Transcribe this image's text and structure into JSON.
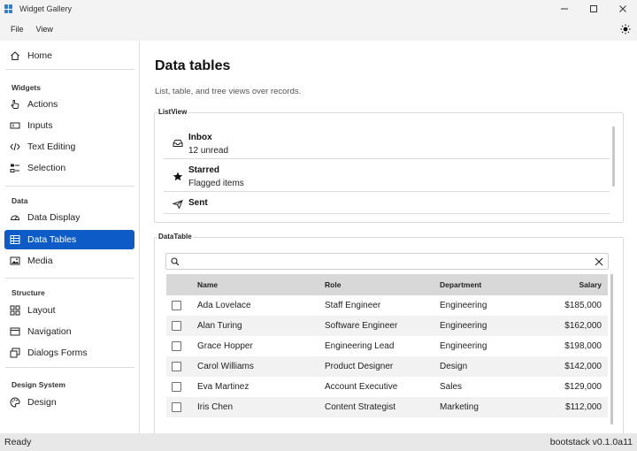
{
  "window": {
    "title": "Widget Gallery"
  },
  "menu": {
    "items": [
      "File",
      "View"
    ]
  },
  "sidebar": {
    "home": "Home",
    "sections": [
      {
        "label": "Widgets",
        "items": [
          "Actions",
          "Inputs",
          "Text Editing",
          "Selection"
        ]
      },
      {
        "label": "Data",
        "items": [
          "Data Display",
          "Data Tables",
          "Media"
        ]
      },
      {
        "label": "Structure",
        "items": [
          "Layout",
          "Navigation",
          "Dialogs  Forms"
        ]
      },
      {
        "label": "Design System",
        "items": [
          "Design"
        ]
      }
    ],
    "active_item": "Data Tables"
  },
  "main": {
    "title": "Data tables",
    "subtitle": "List, table, and tree views over records.",
    "listview": {
      "label": "ListView",
      "items": [
        {
          "title": "Inbox",
          "subtitle": "12 unread",
          "icon": "inbox-icon"
        },
        {
          "title": "Starred",
          "subtitle": "Flagged items",
          "icon": "star-icon"
        },
        {
          "title": "Sent",
          "subtitle": "",
          "icon": "send-icon"
        }
      ]
    },
    "datatable": {
      "label": "DataTable",
      "search": {
        "value": "",
        "placeholder": ""
      },
      "columns": [
        "Name",
        "Role",
        "Department",
        "Salary"
      ],
      "rows": [
        [
          "Ada Lovelace",
          "Staff Engineer",
          "Engineering",
          "$185,000"
        ],
        [
          "Alan Turing",
          "Software Engineer",
          "Engineering",
          "$162,000"
        ],
        [
          "Grace Hopper",
          "Engineering Lead",
          "Engineering",
          "$198,000"
        ],
        [
          "Carol Williams",
          "Product Designer",
          "Design",
          "$142,000"
        ],
        [
          "Eva Martinez",
          "Account Executive",
          "Sales",
          "$129,000"
        ],
        [
          "Iris Chen",
          "Content Strategist",
          "Marketing",
          "$112,000"
        ]
      ]
    }
  },
  "status": {
    "left": "Ready",
    "right": "bootstack v0.1.0a11"
  },
  "colors": {
    "accent": "#0d5bc6",
    "header_bg": "#d8d8d8",
    "row_alt": "#f2f2f2"
  }
}
